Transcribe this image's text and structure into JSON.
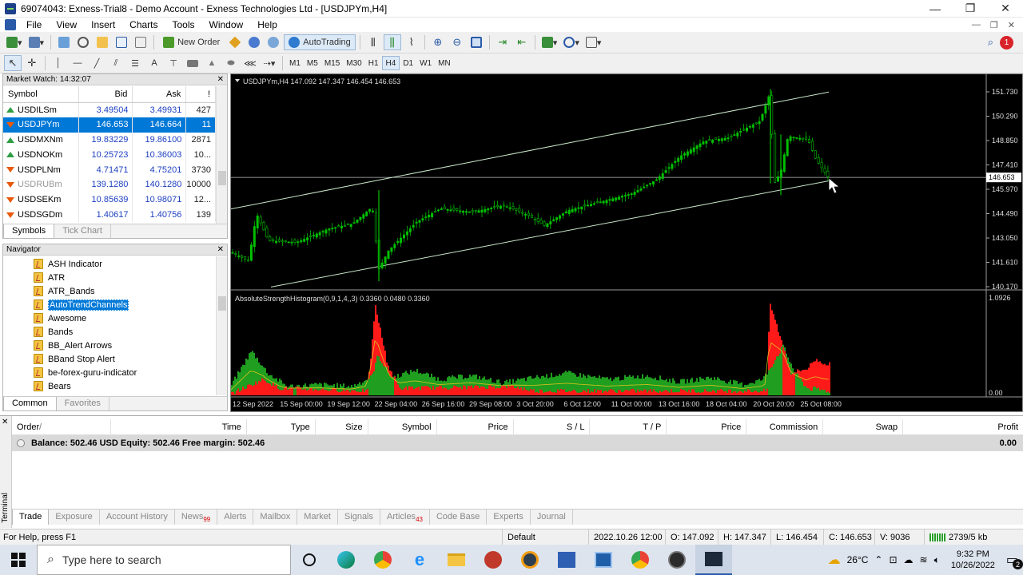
{
  "window": {
    "title": "69074043: Exness-Trial8 - Demo Account - Exness Technologies Ltd - [USDJPYm,H4]",
    "minimize": "—",
    "maximize": "❐",
    "close": "✕"
  },
  "menu": [
    "File",
    "View",
    "Insert",
    "Charts",
    "Tools",
    "Window",
    "Help"
  ],
  "toolbar": {
    "new_order": "New Order",
    "autotrading": "AutoTrading",
    "timeframes": [
      "M1",
      "M5",
      "M15",
      "M30",
      "H1",
      "H4",
      "D1",
      "W1",
      "MN"
    ],
    "active_timeframe": "H4",
    "notification_count": "1"
  },
  "market_watch": {
    "title": "Market Watch: 14:32:07",
    "columns": [
      "Symbol",
      "Bid",
      "Ask",
      "!"
    ],
    "rows": [
      {
        "symbol": "USDILSm",
        "bid": "3.49504",
        "ask": "3.49931",
        "spread": "427",
        "dir": "up"
      },
      {
        "symbol": "USDJPYm",
        "bid": "146.653",
        "ask": "146.664",
        "spread": "11",
        "dir": "dn",
        "selected": true
      },
      {
        "symbol": "USDMXNm",
        "bid": "19.83229",
        "ask": "19.86100",
        "spread": "2871",
        "dir": "up"
      },
      {
        "symbol": "USDNOKm",
        "bid": "10.25723",
        "ask": "10.36003",
        "spread": "10...",
        "dir": "up"
      },
      {
        "symbol": "USDPLNm",
        "bid": "4.71471",
        "ask": "4.75201",
        "spread": "3730",
        "dir": "dn"
      },
      {
        "symbol": "USDRUBm",
        "bid": "139.1280",
        "ask": "140.1280",
        "spread": "10000",
        "dir": "dn",
        "dim": true
      },
      {
        "symbol": "USDSEKm",
        "bid": "10.85639",
        "ask": "10.98071",
        "spread": "12...",
        "dir": "dn"
      },
      {
        "symbol": "USDSGDm",
        "bid": "1.40617",
        "ask": "1.40756",
        "spread": "139",
        "dir": "dn"
      }
    ],
    "tabs": [
      "Symbols",
      "Tick Chart"
    ]
  },
  "navigator": {
    "title": "Navigator",
    "items": [
      "ASH Indicator",
      "ATR",
      "ATR_Bands",
      "AutoTrendChannels",
      "Awesome",
      "Bands",
      "BB_Alert Arrows",
      "BBand Stop Alert",
      "be-forex-guru-indicator",
      "Bears"
    ],
    "selected": "AutoTrendChannels",
    "tabs": [
      "Common",
      "Favorites"
    ]
  },
  "chart": {
    "header": "USDJPYm,H4  147.092 147.347 146.454 146.653",
    "price_ticks": [
      "151.730",
      "150.290",
      "148.850",
      "147.410",
      "145.970",
      "144.490",
      "143.050",
      "141.610",
      "140.170"
    ],
    "current_price": "146.653",
    "indicator_header": "AbsoluteStrengthHistogram(0,9,1,4,,3) 0.3360 0.0480 0.3360",
    "indicator_ticks": [
      "1.0926",
      "0.00"
    ],
    "indicator_bottom_label": "0.00",
    "date_ticks": [
      "12 Sep 2022",
      "15 Sep 00:00",
      "19 Sep 12:00",
      "22 Sep 04:00",
      "26 Sep 16:00",
      "29 Sep 08:00",
      "3 Oct 20:00",
      "6 Oct 12:00",
      "11 Oct 00:00",
      "13 Oct 16:00",
      "18 Oct 04:00",
      "20 Oct 20:00",
      "25 Oct 08:00"
    ],
    "colors": {
      "bull": "#00c000",
      "hist_bull": "#1f9e1f",
      "hist_bear": "#ff1a1a",
      "channel": "#c8e6c8",
      "price_line": "#c0c0c0"
    }
  },
  "terminal": {
    "side_label": "Terminal",
    "columns": [
      "Order",
      "/",
      "Time",
      "Type",
      "Size",
      "Symbol",
      "Price",
      "S / L",
      "T / P",
      "Price",
      "Commission",
      "Swap",
      "Profit"
    ],
    "balance": "Balance: 502.46 USD  Equity: 502.46  Free margin: 502.46",
    "profit": "0.00",
    "tabs": [
      {
        "label": "Trade",
        "badge": ""
      },
      {
        "label": "Exposure",
        "badge": ""
      },
      {
        "label": "Account History",
        "badge": ""
      },
      {
        "label": "News",
        "badge": "99"
      },
      {
        "label": "Alerts",
        "badge": ""
      },
      {
        "label": "Mailbox",
        "badge": ""
      },
      {
        "label": "Market",
        "badge": ""
      },
      {
        "label": "Signals",
        "badge": ""
      },
      {
        "label": "Articles",
        "badge": "43"
      },
      {
        "label": "Code Base",
        "badge": ""
      },
      {
        "label": "Experts",
        "badge": ""
      },
      {
        "label": "Journal",
        "badge": ""
      }
    ],
    "active_tab": "Trade"
  },
  "status": {
    "help": "For Help, press F1",
    "profile": "Default",
    "datetime": "2022.10.26 12:00",
    "open": "O: 147.092",
    "high": "H: 147.347",
    "low": "L: 146.454",
    "close": "C: 146.653",
    "volume": "V: 9036",
    "traffic": "2739/5 kb"
  },
  "taskbar": {
    "search_placeholder": "Type here to search",
    "weather": "26°C",
    "time": "9:32 PM",
    "date": "10/26/2022",
    "notification_count": "2"
  }
}
